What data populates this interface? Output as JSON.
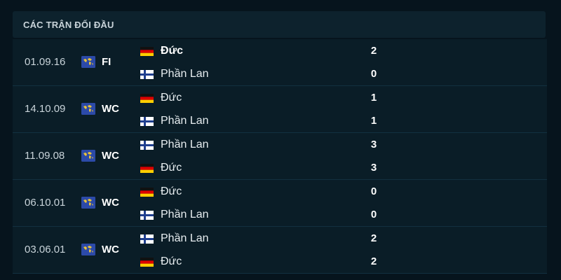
{
  "header": {
    "title": "CÁC TRẬN ĐỐI ĐẦU"
  },
  "matches": [
    {
      "date": "01.09.16",
      "competition": "FI",
      "home": {
        "name": "Đức",
        "flag": "germany",
        "score": "2",
        "bold": true
      },
      "away": {
        "name": "Phần Lan",
        "flag": "finland",
        "score": "0",
        "bold": false
      }
    },
    {
      "date": "14.10.09",
      "competition": "WC",
      "home": {
        "name": "Đức",
        "flag": "germany",
        "score": "1",
        "bold": false
      },
      "away": {
        "name": "Phần Lan",
        "flag": "finland",
        "score": "1",
        "bold": false
      }
    },
    {
      "date": "11.09.08",
      "competition": "WC",
      "home": {
        "name": "Phần Lan",
        "flag": "finland",
        "score": "3",
        "bold": false
      },
      "away": {
        "name": "Đức",
        "flag": "germany",
        "score": "3",
        "bold": false
      }
    },
    {
      "date": "06.10.01",
      "competition": "WC",
      "home": {
        "name": "Đức",
        "flag": "germany",
        "score": "0",
        "bold": false
      },
      "away": {
        "name": "Phần Lan",
        "flag": "finland",
        "score": "0",
        "bold": false
      }
    },
    {
      "date": "03.06.01",
      "competition": "WC",
      "home": {
        "name": "Phần Lan",
        "flag": "finland",
        "score": "2",
        "bold": false
      },
      "away": {
        "name": "Đức",
        "flag": "germany",
        "score": "2",
        "bold": false
      }
    }
  ],
  "colors": {
    "background": "#06141d",
    "header": "#0d222d",
    "row": "#0a1d27",
    "text": "#ffffff"
  },
  "icons": {
    "competition": "world-map-icon"
  }
}
